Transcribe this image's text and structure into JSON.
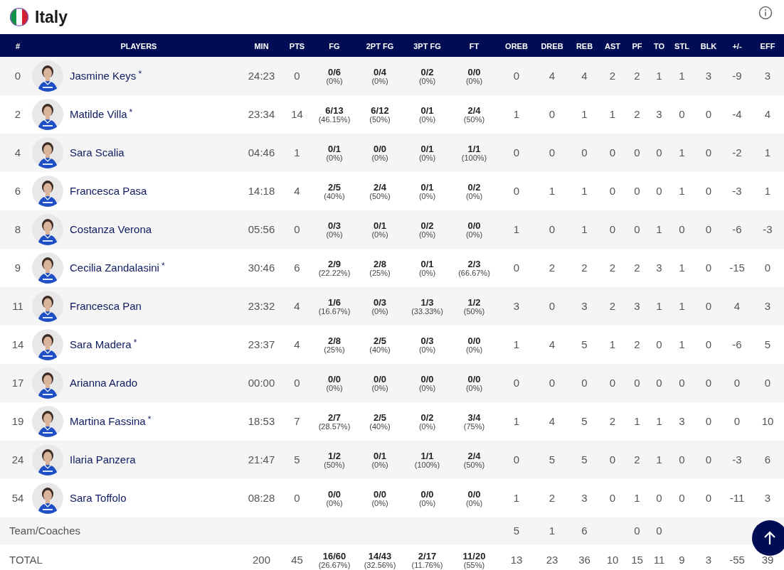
{
  "team": {
    "name": "Italy"
  },
  "columns": [
    "#",
    "PLAYERS",
    "MIN",
    "PTS",
    "FG",
    "2PT FG",
    "3PT FG",
    "FT",
    "OREB",
    "DREB",
    "REB",
    "AST",
    "PF",
    "TO",
    "STL",
    "BLK",
    "+/-",
    "EFF"
  ],
  "players": [
    {
      "number": "0",
      "name": "Jasmine Keys",
      "mark": "*",
      "min": "24:23",
      "pts": "0",
      "shots": [
        [
          "0/6",
          "(0%)"
        ],
        [
          "0/4",
          "(0%)"
        ],
        [
          "0/2",
          "(0%)"
        ],
        [
          "0/0",
          "(0%)"
        ]
      ],
      "counts": [
        "0",
        "4",
        "4",
        "2",
        "2",
        "1",
        "1",
        "3",
        "-9",
        "3"
      ]
    },
    {
      "number": "2",
      "name": "Matilde Villa",
      "mark": "*",
      "min": "23:34",
      "pts": "14",
      "shots": [
        [
          "6/13",
          "(46.15%)"
        ],
        [
          "6/12",
          "(50%)"
        ],
        [
          "0/1",
          "(0%)"
        ],
        [
          "2/4",
          "(50%)"
        ]
      ],
      "counts": [
        "1",
        "0",
        "1",
        "1",
        "2",
        "3",
        "0",
        "0",
        "-4",
        "4"
      ]
    },
    {
      "number": "4",
      "name": "Sara Scalia",
      "min": "04:46",
      "pts": "1",
      "shots": [
        [
          "0/1",
          "(0%)"
        ],
        [
          "0/0",
          "(0%)"
        ],
        [
          "0/1",
          "(0%)"
        ],
        [
          "1/1",
          "(100%)"
        ]
      ],
      "counts": [
        "0",
        "0",
        "0",
        "0",
        "0",
        "0",
        "1",
        "0",
        "-2",
        "1"
      ]
    },
    {
      "number": "6",
      "name": "Francesca Pasa",
      "min": "14:18",
      "pts": "4",
      "shots": [
        [
          "2/5",
          "(40%)"
        ],
        [
          "2/4",
          "(50%)"
        ],
        [
          "0/1",
          "(0%)"
        ],
        [
          "0/2",
          "(0%)"
        ]
      ],
      "counts": [
        "0",
        "1",
        "1",
        "0",
        "0",
        "0",
        "1",
        "0",
        "-3",
        "1"
      ]
    },
    {
      "number": "8",
      "name": "Costanza Verona",
      "min": "05:56",
      "pts": "0",
      "shots": [
        [
          "0/3",
          "(0%)"
        ],
        [
          "0/1",
          "(0%)"
        ],
        [
          "0/2",
          "(0%)"
        ],
        [
          "0/0",
          "(0%)"
        ]
      ],
      "counts": [
        "1",
        "0",
        "1",
        "0",
        "0",
        "1",
        "0",
        "0",
        "-6",
        "-3"
      ]
    },
    {
      "number": "9",
      "name": "Cecilia Zandalasini",
      "mark": "*",
      "min": "30:46",
      "pts": "6",
      "shots": [
        [
          "2/9",
          "(22.22%)"
        ],
        [
          "2/8",
          "(25%)"
        ],
        [
          "0/1",
          "(0%)"
        ],
        [
          "2/3",
          "(66.67%)"
        ]
      ],
      "counts": [
        "0",
        "2",
        "2",
        "2",
        "2",
        "3",
        "1",
        "0",
        "-15",
        "0"
      ]
    },
    {
      "number": "11",
      "name": "Francesca Pan",
      "min": "23:32",
      "pts": "4",
      "shots": [
        [
          "1/6",
          "(16.67%)"
        ],
        [
          "0/3",
          "(0%)"
        ],
        [
          "1/3",
          "(33.33%)"
        ],
        [
          "1/2",
          "(50%)"
        ]
      ],
      "counts": [
        "3",
        "0",
        "3",
        "2",
        "3",
        "1",
        "1",
        "0",
        "4",
        "3"
      ]
    },
    {
      "number": "14",
      "name": "Sara Madera",
      "mark": "*",
      "min": "23:37",
      "pts": "4",
      "shots": [
        [
          "2/8",
          "(25%)"
        ],
        [
          "2/5",
          "(40%)"
        ],
        [
          "0/3",
          "(0%)"
        ],
        [
          "0/0",
          "(0%)"
        ]
      ],
      "counts": [
        "1",
        "4",
        "5",
        "1",
        "2",
        "0",
        "1",
        "0",
        "-6",
        "5"
      ]
    },
    {
      "number": "17",
      "name": "Arianna Arado",
      "min": "00:00",
      "pts": "0",
      "shots": [
        [
          "0/0",
          "(0%)"
        ],
        [
          "0/0",
          "(0%)"
        ],
        [
          "0/0",
          "(0%)"
        ],
        [
          "0/0",
          "(0%)"
        ]
      ],
      "counts": [
        "0",
        "0",
        "0",
        "0",
        "0",
        "0",
        "0",
        "0",
        "0",
        "0"
      ]
    },
    {
      "number": "19",
      "name": "Martina Fassina",
      "mark": "*",
      "min": "18:53",
      "pts": "7",
      "shots": [
        [
          "2/7",
          "(28.57%)"
        ],
        [
          "2/5",
          "(40%)"
        ],
        [
          "0/2",
          "(0%)"
        ],
        [
          "3/4",
          "(75%)"
        ]
      ],
      "counts": [
        "1",
        "4",
        "5",
        "2",
        "1",
        "1",
        "3",
        "0",
        "0",
        "10"
      ]
    },
    {
      "number": "24",
      "name": "Ilaria Panzera",
      "min": "21:47",
      "pts": "5",
      "shots": [
        [
          "1/2",
          "(50%)"
        ],
        [
          "0/1",
          "(0%)"
        ],
        [
          "1/1",
          "(100%)"
        ],
        [
          "2/4",
          "(50%)"
        ]
      ],
      "counts": [
        "0",
        "5",
        "5",
        "0",
        "2",
        "1",
        "0",
        "0",
        "-3",
        "6"
      ]
    },
    {
      "number": "54",
      "name": "Sara Toffolo",
      "min": "08:28",
      "pts": "0",
      "shots": [
        [
          "0/0",
          "(0%)"
        ],
        [
          "0/0",
          "(0%)"
        ],
        [
          "0/0",
          "(0%)"
        ],
        [
          "0/0",
          "(0%)"
        ]
      ],
      "counts": [
        "1",
        "2",
        "3",
        "0",
        "1",
        "0",
        "0",
        "0",
        "-11",
        "3"
      ]
    }
  ],
  "team_row": {
    "label": "Team/Coaches",
    "counts": {
      "oreb": "5",
      "dreb": "1",
      "reb": "6",
      "pf": "0",
      "to": "0"
    }
  },
  "total_row": {
    "label": "TOTAL",
    "min": "200",
    "pts": "45",
    "shots": [
      [
        "16/60",
        "(26.67%)"
      ],
      [
        "14/43",
        "(32.56%)"
      ],
      [
        "2/17",
        "(11.76%)"
      ],
      [
        "11/20",
        "(55%)"
      ]
    ],
    "counts": [
      "13",
      "23",
      "36",
      "10",
      "15",
      "11",
      "9",
      "3",
      "-55",
      "39"
    ]
  }
}
